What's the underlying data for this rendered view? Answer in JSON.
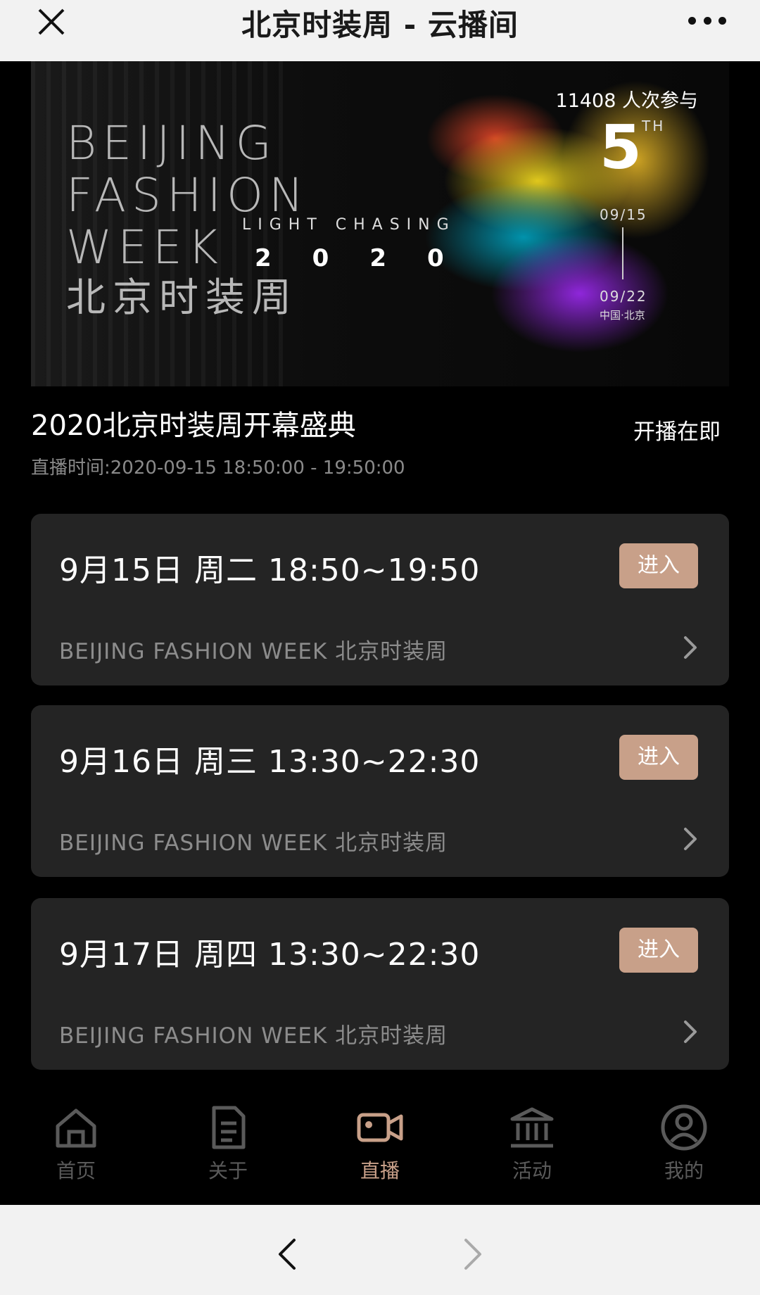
{
  "topbar": {
    "title": "北京时装周 - 云播间"
  },
  "banner": {
    "logo_line1": "BEIJING",
    "logo_line2": "FASHION",
    "logo_line3": "WEEK",
    "logo_line4": "北京时装周",
    "light_chasing": "LIGHT CHASING",
    "year": "2020",
    "participants": "11408 人次参与",
    "edition_number": "5",
    "edition_suffix": "TH",
    "date_start": "09/15",
    "date_end": "09/22",
    "location": "中国·北京"
  },
  "event": {
    "title": "2020北京时装周开幕盛典",
    "status": "开播在即",
    "broadcast_time": "直播时间:2020-09-15 18:50:00 - 19:50:00"
  },
  "sessions": [
    {
      "date": "9月15日  周二  18:50~19:50",
      "button": "进入",
      "subtitle": "BEIJING  FASHION  WEEK  北京时装周"
    },
    {
      "date": "9月16日  周三  13:30~22:30",
      "button": "进入",
      "subtitle": "BEIJING  FASHION  WEEK  北京时装周"
    },
    {
      "date": "9月17日  周四  13:30~22:30",
      "button": "进入",
      "subtitle": "BEIJING  FASHION  WEEK  北京时装周"
    }
  ],
  "tabs": [
    {
      "label": "首页",
      "icon": "home-icon"
    },
    {
      "label": "关于",
      "icon": "document-icon"
    },
    {
      "label": "直播",
      "icon": "video-camera-icon",
      "active": true
    },
    {
      "label": "活动",
      "icon": "building-icon"
    },
    {
      "label": "我的",
      "icon": "user-icon"
    }
  ],
  "colors": {
    "accent": "#c8a089",
    "card_bg": "#242424",
    "inactive_tab": "#5a5a5a",
    "topbar_bg": "#f2f2f2"
  }
}
